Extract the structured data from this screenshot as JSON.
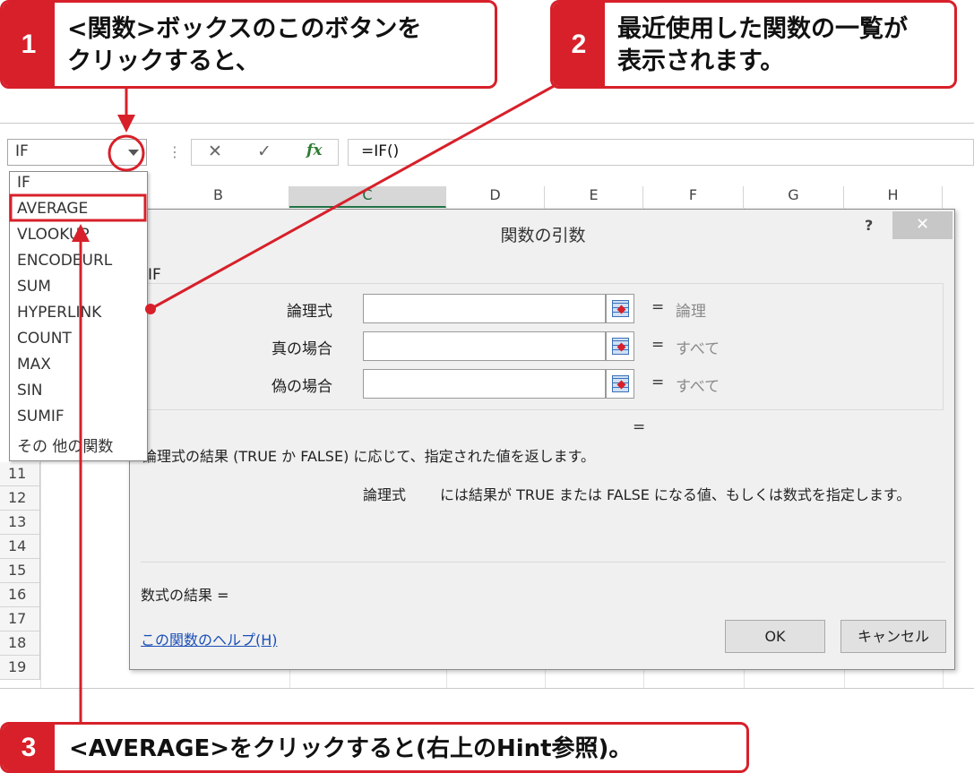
{
  "callouts": {
    "step1": {
      "number": "1",
      "text": "<関数>ボックスのこのボタンを\nクリックすると、"
    },
    "step2": {
      "number": "2",
      "text": "最近使用した関数の一覧が\n表示されます。"
    },
    "step3": {
      "number": "3",
      "text": "<AVERAGE>をクリックすると(右上のHint参照)。"
    }
  },
  "formula_bar": {
    "name_box_value": "IF",
    "dots": "⋮",
    "cancel_glyph": "✕",
    "enter_glyph": "✓",
    "fx_label": "fx",
    "formula_value": "=IF()"
  },
  "columns": [
    "B",
    "C",
    "D",
    "E",
    "F",
    "G",
    "H"
  ],
  "selected_column": "C",
  "rows": [
    "11",
    "12",
    "13",
    "14",
    "15",
    "16",
    "17",
    "18",
    "19"
  ],
  "function_list": {
    "items": [
      "IF",
      "AVERAGE",
      "VLOOKUP",
      "ENCODEURL",
      "SUM",
      "HYPERLINK",
      "COUNT",
      "MAX",
      "SIN",
      "SUMIF",
      "その 他の関数"
    ],
    "highlighted": "AVERAGE"
  },
  "dialog": {
    "title": "関数の引数",
    "help_glyph": "?",
    "close_glyph": "✕",
    "function_name": "IF",
    "arguments": [
      {
        "label": "論理式",
        "value": "",
        "hint": "論理"
      },
      {
        "label": "真の場合",
        "value": "",
        "hint": "すべて"
      },
      {
        "label": "偽の場合",
        "value": "",
        "hint": "すべて"
      }
    ],
    "equals": "=",
    "result_equals": "=",
    "description": "論理式の結果 (TRUE か FALSE) に応じて、指定された値を返します。",
    "arg_description_name": "論理式",
    "arg_description": "には結果が TRUE または FALSE になる値、もしくは数式を指定します。",
    "formula_result": "数式の結果 =",
    "help_link": "この関数のヘルプ(H)",
    "ok_label": "OK",
    "cancel_label": "キャンセル"
  },
  "colors": {
    "accent_red": "#d7202a",
    "excel_green": "#217346",
    "link_blue": "#1a4fb8"
  }
}
